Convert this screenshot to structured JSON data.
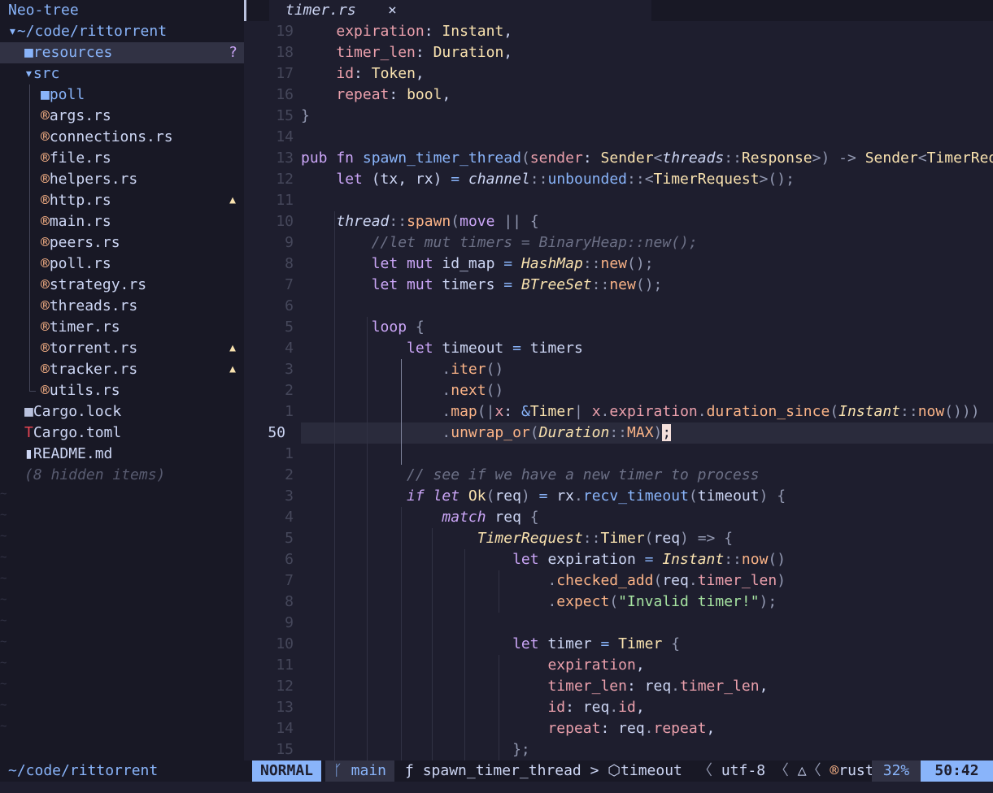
{
  "sidebar": {
    "title": "Neo-tree",
    "root": "~/code/rittorrent",
    "items": [
      {
        "label": "resources",
        "kind": "folder",
        "badge": "?"
      },
      {
        "label": "src",
        "kind": "folder-open"
      },
      {
        "label": "poll",
        "kind": "folder"
      },
      {
        "label": "args.rs",
        "kind": "rust"
      },
      {
        "label": "connections.rs",
        "kind": "rust"
      },
      {
        "label": "file.rs",
        "kind": "rust"
      },
      {
        "label": "helpers.rs",
        "kind": "rust"
      },
      {
        "label": "http.rs",
        "kind": "rust",
        "badge": "▲"
      },
      {
        "label": "main.rs",
        "kind": "rust"
      },
      {
        "label": "peers.rs",
        "kind": "rust"
      },
      {
        "label": "poll.rs",
        "kind": "rust"
      },
      {
        "label": "strategy.rs",
        "kind": "rust"
      },
      {
        "label": "threads.rs",
        "kind": "rust"
      },
      {
        "label": "timer.rs",
        "kind": "rust"
      },
      {
        "label": "torrent.rs",
        "kind": "rust",
        "badge": "▲"
      },
      {
        "label": "tracker.rs",
        "kind": "rust",
        "badge": "▲"
      },
      {
        "label": "utils.rs",
        "kind": "rust"
      },
      {
        "label": "Cargo.lock",
        "kind": "lock"
      },
      {
        "label": "Cargo.toml",
        "kind": "toml"
      },
      {
        "label": "README.md",
        "kind": "md"
      }
    ],
    "hidden": "(8 hidden items)"
  },
  "tab": {
    "label": "timer.rs",
    "close": "×"
  },
  "gutter": [
    "19",
    "18",
    "17",
    "16",
    "15",
    "14",
    "13",
    "12",
    "11",
    "10",
    "9",
    "8",
    "7",
    "6",
    "5",
    "4",
    "3",
    "2",
    "1",
    "50",
    "1",
    "2",
    "3",
    "4",
    "5",
    "6",
    "7",
    "8",
    "9",
    "10",
    "11",
    "12",
    "13",
    "14",
    "15"
  ],
  "status": {
    "cwd": "~/code/rittorrent",
    "mode": "NORMAL",
    "branch": "main",
    "crumb_fn": "spawn_timer_thread",
    "crumb_sep": ">",
    "crumb_var": "timeout",
    "encoding": "utf-8",
    "filetype": "rust",
    "percent": "32%",
    "position": "50:42"
  },
  "colors": {
    "accent": "#89b4fa",
    "bg": "#1e1e2e",
    "sidebar": "#181825",
    "keyword": "#cba6f7",
    "type": "#f9e2af",
    "string": "#a6e3a1"
  }
}
